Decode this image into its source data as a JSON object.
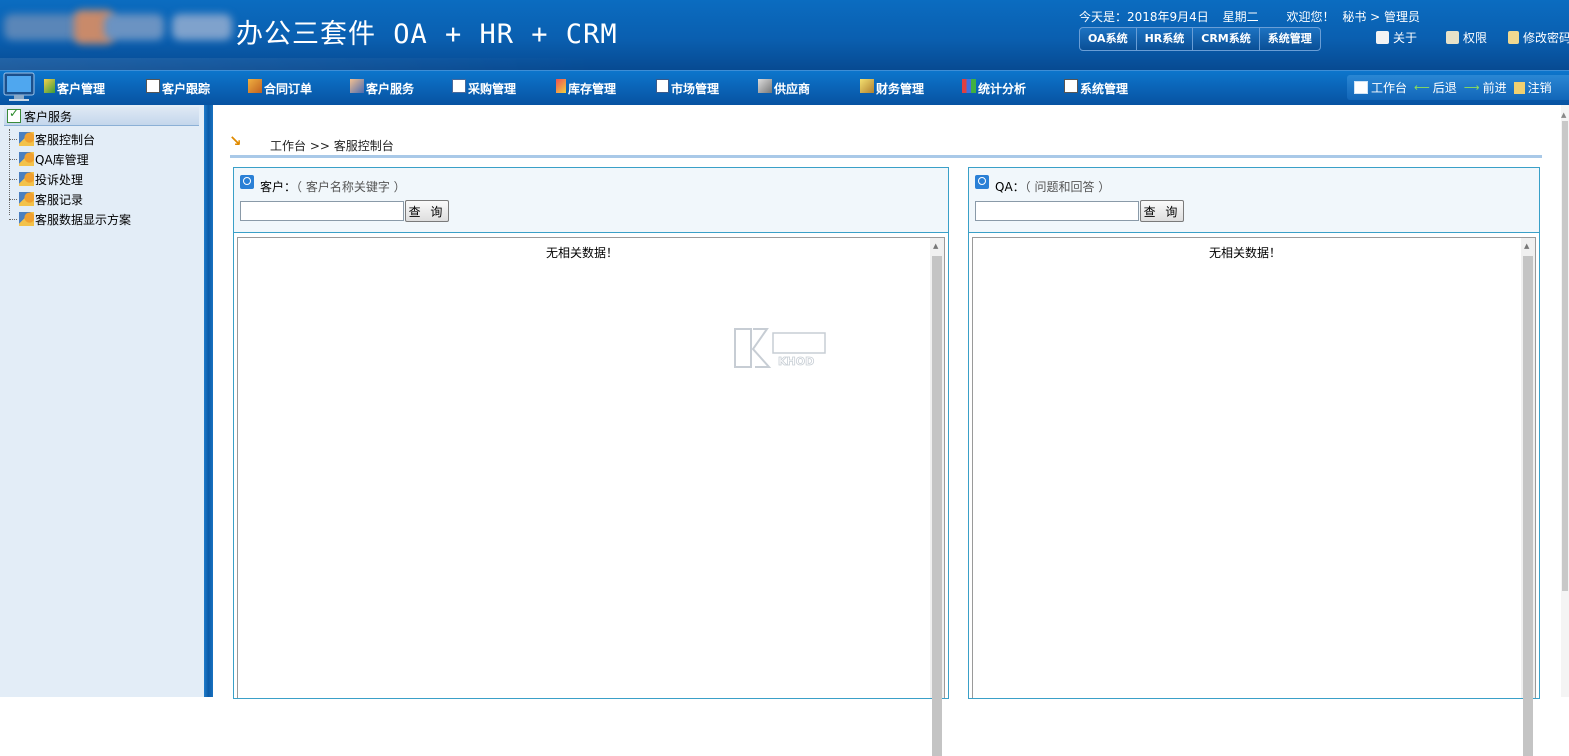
{
  "header": {
    "app_title": "办公三套件 OA + HR + CRM",
    "date_label": "今天是：2018年9月4日",
    "weekday": "星期二",
    "welcome": "欢迎您！",
    "user": "秘书 > 管理员",
    "system_tabs": [
      "OA系统",
      "HR系统",
      "CRM系统",
      "系统管理"
    ],
    "links": {
      "about": "关于",
      "permissions": "权限",
      "change_password": "修改密码"
    }
  },
  "menu": {
    "items": [
      "客户管理",
      "客户跟踪",
      "合同订单",
      "客户服务",
      "采购管理",
      "库存管理",
      "市场管理",
      "供应商",
      "财务管理",
      "统计分析",
      "系统管理"
    ]
  },
  "quick": {
    "workbench": "工作台",
    "back": "后退",
    "forward": "前进",
    "logout": "注销"
  },
  "sidebar": {
    "title": "客户服务",
    "items": [
      "客服控制台",
      "QA库管理",
      "投诉处理",
      "客服记录",
      "客服数据显示方案"
    ]
  },
  "breadcrumb": "工作台 >> 客服控制台",
  "panels": {
    "customer": {
      "label": "客户：",
      "hint": "（ 客户名称关键字 ）",
      "input_value": "",
      "button": "查 询",
      "empty_text": "无相关数据！"
    },
    "qa": {
      "label": "QA：",
      "hint": "（ 问题和回答 ）",
      "input_value": "",
      "button": "查 询",
      "empty_text": "无相关数据！"
    }
  },
  "watermark": {
    "text": "KHOD"
  },
  "colors": {
    "header_blue": "#0a5fb0",
    "panel_border": "#3aa0c8",
    "sidebar_bg": "#e3edf7"
  }
}
